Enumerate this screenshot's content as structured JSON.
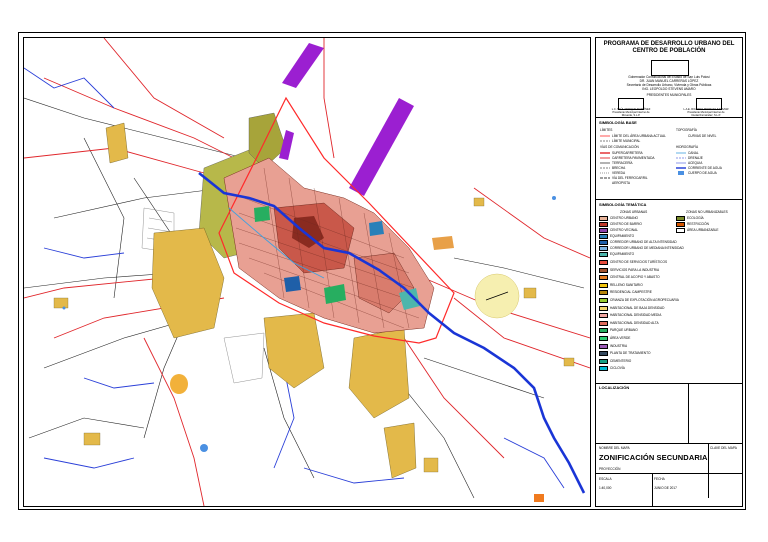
{
  "map_legend": {
    "program_title": "PROGRAMA DE DESARROLLO URBANO DEL CENTRO DE POBLACIÓN",
    "signatories": [
      "Gobernador Constitucional del Estado de San Luis Potosí",
      "DR. JUAN MANUEL CARRERAS LÓPEZ",
      "Secretario de Desarrollo Urbano, Vivienda y Obras Públicas",
      "ING. LEOPOLDO STEVENS AMARO",
      "PRESIDENTES MUNICIPALES"
    ],
    "sig_left": [
      "L.C. SAÚL ENRIQUE MARTÍNEZ",
      "Presidente Municipal Interino de",
      "Rioverde, S.L.P."
    ],
    "sig_right": [
      "L.A.E. RICARDO PEDRAZA SALAZAR",
      "Presidente Municipal Interino de",
      "Ciudad Fernández, S.L.P."
    ],
    "base_symbology": "SIMBOLOGÍA BASE",
    "limits_header": "LÍMITES",
    "limits": [
      "LÍMITE DEL ÁREA URBANA ACTUAL",
      "LÍMITE MUNICIPAL"
    ],
    "roads_header": "VÍAS DE COMUNICACIÓN",
    "roads": [
      "SUPERCARRETERA",
      "CARRETERA PAVIMENTADA",
      "TERRACERÍA",
      "BRECHA",
      "VEREDA",
      "VÍA DEL FERROCARRIL",
      "AEROPISTA"
    ],
    "topo_header": "TOPOGRAFÍA",
    "topo": [
      "CURVAS DE NIVEL"
    ],
    "hydro_header": "HIDROGRAFÍA",
    "hydro": [
      "CANAL",
      "DRENAJE",
      "ACEQUIA",
      "CORRIENTE DE AGUA",
      "CUERPO DE AGUA"
    ],
    "thematic_title": "SIMBOLOGÍA TEMÁTICA",
    "urban_zones_header": "ZONAS URBANAS",
    "urban_zones": [
      {
        "label": "CENTRO URBANO",
        "color": "#e8b49a"
      },
      {
        "label": "CENTRO DE BARRIO",
        "color": "#c0392b"
      },
      {
        "label": "CENTRO VECINAL",
        "color": "#8e44ad"
      },
      {
        "label": "EQUIPAMIENTO",
        "color": "#2980b9"
      },
      {
        "label": "CORREDOR URBANO DE ALTA INTENSIDAD",
        "color": "#1f5fa8"
      },
      {
        "label": "CORREDOR URBANO DE MEDIANA INTENSIDAD",
        "color": "#7fb3e0"
      },
      {
        "label": "EQUIPAMIENTO",
        "color": "#4db6ac"
      }
    ],
    "non_urban_header": "ZONAS NO URBANIZABLES",
    "non_urban": [
      {
        "label": "ECOLOGÍA",
        "color": "#7a8b2a"
      },
      {
        "label": "RESTRICCIÓN",
        "color": "#d35400"
      },
      {
        "label": "ÁREA URBANIZABLE",
        "color": "#ffffff"
      }
    ],
    "uses": [
      {
        "label": "CENTRO DE SERVICIOS TURÍSTICOS",
        "color": "#e74c3c"
      },
      {
        "label": "SERVICIOS PARA LA INDUSTRIA",
        "color": "#a0522d"
      },
      {
        "label": "CENTRAL DE ACOPIO Y ABASTO",
        "color": "#e67e22"
      },
      {
        "label": "RELLENO SANITARIO",
        "color": "#f1c40f"
      },
      {
        "label": "RESIDENCIAL CAMPESTRE",
        "color": "#b8860b"
      },
      {
        "label": "CRIANZA DE EXPLOTACIÓN AGROPECUARIA",
        "color": "#9acd32"
      },
      {
        "label": "HABITACIONAL DE BAJA DENSIDAD",
        "color": "#f5d76e"
      },
      {
        "label": "HABITACIONAL DENSIDAD MEDIA",
        "color": "#f0a5a0"
      },
      {
        "label": "HABITACIONAL DENSIDAD ALTA",
        "color": "#e06b5c"
      },
      {
        "label": "PARQUE URBANO",
        "color": "#27ae60"
      },
      {
        "label": "ÁREA VERDE",
        "color": "#2ecc71"
      },
      {
        "label": "INDUSTRIA",
        "color": "#9b59b6"
      },
      {
        "label": "PLANTA DE TRATAMIENTO",
        "color": "#34495e"
      },
      {
        "label": "CEMENTERIO",
        "color": "#16a085"
      },
      {
        "label": "CICLOVÍA",
        "color": "#00bcd4"
      }
    ],
    "location_label": "LOCALIZACIÓN",
    "map_name_label": "NOMBRE DEL MAPA",
    "map_name": "ZONIFICACIÓN SECUNDARIA",
    "map_key_label": "CLAVE DEL MAPA",
    "projection_label": "PROYECCIÓN",
    "scale_label": "ESCALA",
    "scale_value": "1:40,000",
    "date_label": "FECHA",
    "date_value": "JUNIO DE 2017"
  },
  "colors": {
    "river": "#1a35d6",
    "road": "#e0262b",
    "urban_limit": "#ff2a2a",
    "industry": "#9b1fd1",
    "residential_low": "#e3b94a",
    "agricultural": "#b7b84a",
    "dense_core": "#c0392b"
  }
}
